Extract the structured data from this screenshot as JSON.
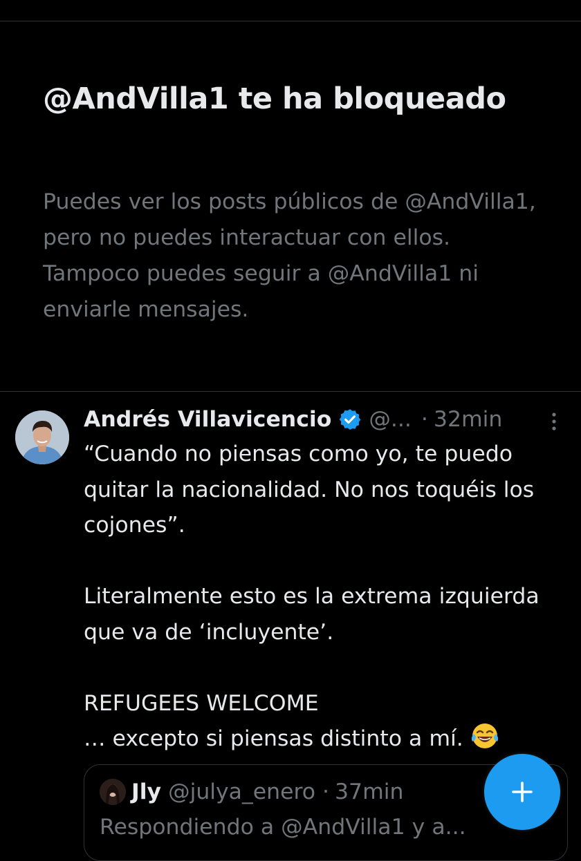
{
  "blocked_notice": {
    "title": "@AndVilla1 te ha bloqueado",
    "description": "Puedes ver los posts públicos de @AndVilla1, pero no puedes interactuar con ellos. Tampoco puedes seguir a @AndVilla1 ni enviarle mensajes."
  },
  "tweet": {
    "author_name": "Andrés Villavicencio",
    "handle": "@...",
    "separator": "·",
    "time": "32min",
    "verified_icon": "verified-badge-icon",
    "more_icon": "more-vertical-icon",
    "text_lines": [
      "“Cuando no piensas como yo, te puedo quitar la nacionalidad. No nos toquéis los cojones”.",
      "Literalmente esto es la extrema izquierda que va de ‘incluyente’.",
      "REFUGEES WELCOME",
      "… excepto si piensas distinto a mí."
    ],
    "emoji": "face-with-tears-of-joy-icon"
  },
  "quoted_tweet": {
    "author_name": "Jly",
    "handle": "@julya_enero",
    "separator": "·",
    "time": "37min",
    "text": "Respondiendo a @AndVilla1 y a..."
  },
  "fab": {
    "icon": "plus-icon"
  },
  "colors": {
    "background": "#000000",
    "primary_text": "#e7e9ea",
    "secondary_text": "#71767b",
    "accent": "#1d9bf0",
    "divider": "#2f3336"
  }
}
